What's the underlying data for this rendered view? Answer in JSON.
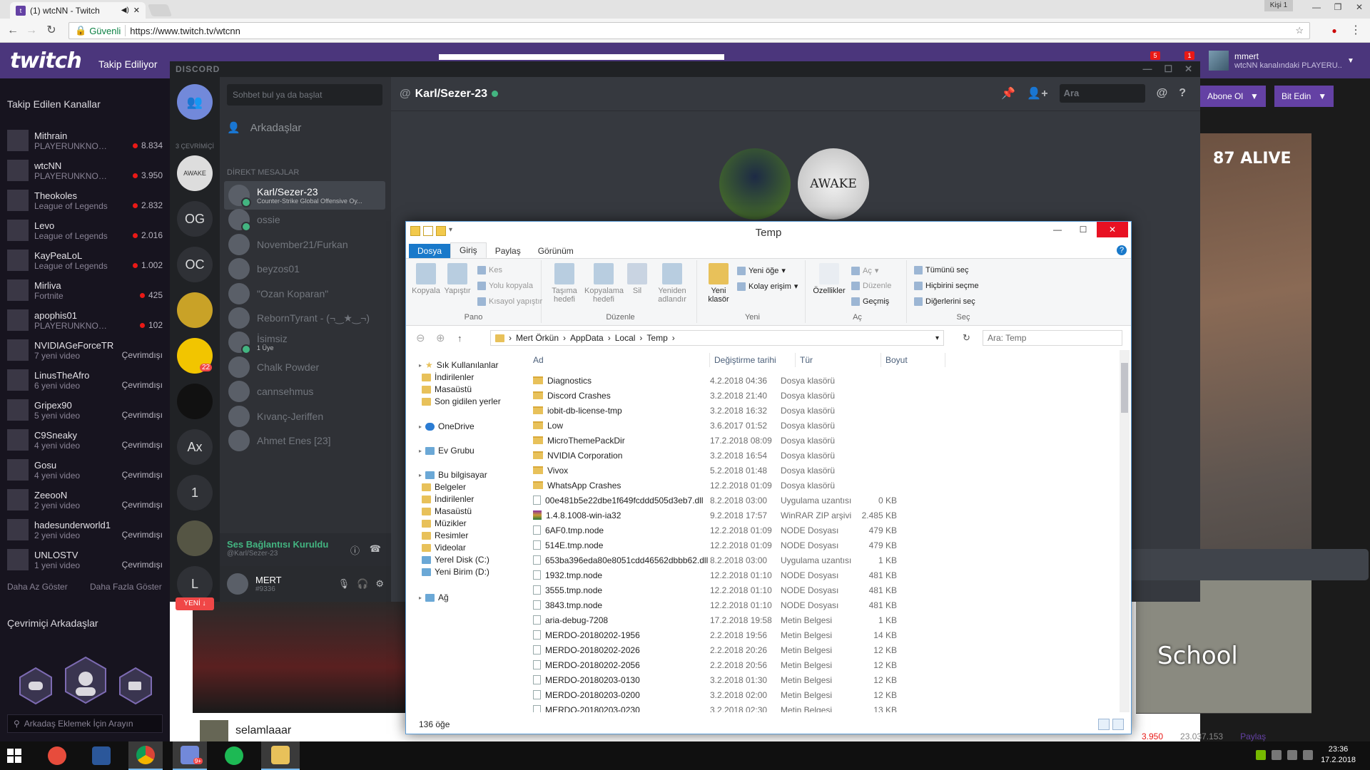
{
  "chrome": {
    "tab_title": "(1) wtcNN - Twitch",
    "profile_chip": "Kişi 1",
    "secure_label": "Güvenli",
    "url": "https://www.twitch.tv/wtcnn"
  },
  "twitch": {
    "logo": "twitch",
    "nav_following": "Takip Ediliyor",
    "user": {
      "name": "mmert",
      "subtitle": "wtcNN kanalındaki PLAYERU..."
    },
    "notif_badges": [
      "5",
      "1"
    ],
    "sidebar_title": "Takip Edilen Kanallar",
    "channels": [
      {
        "name": "Mithrain",
        "game": "PLAYERUNKNOWN'...",
        "stat": "8.834",
        "live": true
      },
      {
        "name": "wtcNN",
        "game": "PLAYERUNKNOWN'...",
        "stat": "3.950",
        "live": true
      },
      {
        "name": "Theokoles",
        "game": "League of Legends",
        "stat": "2.832",
        "live": true
      },
      {
        "name": "Levo",
        "game": "League of Legends",
        "stat": "2.016",
        "live": true
      },
      {
        "name": "KayPeaLoL",
        "game": "League of Legends",
        "stat": "1.002",
        "live": true
      },
      {
        "name": "Mirliva",
        "game": "Fortnite",
        "stat": "425",
        "live": true
      },
      {
        "name": "apophis01",
        "game": "PLAYERUNKNOWN'S ...",
        "stat": "102",
        "live": true
      },
      {
        "name": "NVIDIAGeForceTR",
        "game": "7 yeni video",
        "stat": "Çevrimdışı",
        "live": false
      },
      {
        "name": "LinusTheAfro",
        "game": "6 yeni video",
        "stat": "Çevrimdışı",
        "live": false
      },
      {
        "name": "Gripex90",
        "game": "5 yeni video",
        "stat": "Çevrimdışı",
        "live": false
      },
      {
        "name": "C9Sneaky",
        "game": "4 yeni video",
        "stat": "Çevrimdışı",
        "live": false
      },
      {
        "name": "Gosu",
        "game": "4 yeni video",
        "stat": "Çevrimdışı",
        "live": false
      },
      {
        "name": "ZeeooN",
        "game": "2 yeni video",
        "stat": "Çevrimdışı",
        "live": false
      },
      {
        "name": "hadesunderworld1",
        "game": "2 yeni video",
        "stat": "Çevrimdışı",
        "live": false
      },
      {
        "name": "UNLOSTV",
        "game": "1 yeni video",
        "stat": "Çevrimdışı",
        "live": false
      }
    ],
    "show_less": "Daha Az Göster",
    "show_more": "Daha Fazla Göster",
    "online_friends": "Çevrimiçi Arkadaşlar",
    "friend_search": "Arkadaş Eklemek İçin Arayın",
    "subscribe": "Abone Ol",
    "bits": "Bit Edin",
    "alive": "87 ALIVE",
    "map_label": "School",
    "chat_message": "selamlaaar",
    "viewers": "3.950",
    "views": "23.037.153",
    "share": "Paylaş"
  },
  "discord": {
    "title_brand": "DISCORD",
    "online_count": "3 ÇEVRİMİÇİ",
    "guilds": [
      "OG",
      "OC",
      "Ax",
      "1",
      "L"
    ],
    "guild_badge": "22",
    "new_label": "YENİ ↓",
    "search_placeholder": "Sohbet bul ya da başlat",
    "friends": "Arkadaşlar",
    "dm_header": "DİREKT MESAJLAR",
    "dms": [
      {
        "name": "Karl/Sezer-23",
        "sub": "Counter-Strike Global Offensive Oy...",
        "active": true
      },
      {
        "name": "ossie",
        "sub": ""
      },
      {
        "name": "November21/Furkan",
        "sub": ""
      },
      {
        "name": "beyzos01",
        "sub": ""
      },
      {
        "name": "\"Ozan Koparan\"",
        "sub": ""
      },
      {
        "name": "RebornTyrant - (¬‿★‿¬)",
        "sub": ""
      },
      {
        "name": "İsimsiz",
        "sub": "1 Üye"
      },
      {
        "name": "Chalk Powder",
        "sub": ""
      },
      {
        "name": "cannsehmus",
        "sub": ""
      },
      {
        "name": "Kıvanç-Jeriffen",
        "sub": ""
      },
      {
        "name": "Ahmet Enes [23]",
        "sub": ""
      }
    ],
    "voice_title": "Ses Bağlantısı Kuruldu",
    "voice_sub": "@Karl/Sezer-23",
    "username": "MERT",
    "usertag": "#9336",
    "chat_title": "Karl/Sezer-23",
    "chat_search": "Ara",
    "awake_label": "AWAKE"
  },
  "explorer": {
    "title": "Temp",
    "tabs": [
      "Dosya",
      "Giriş",
      "Paylaş",
      "Görünüm"
    ],
    "ribbon": {
      "pano": "Pano",
      "duzenle": "Düzenle",
      "yeni": "Yeni",
      "ac": "Aç",
      "sec": "Seç",
      "kopyala": "Kopyala",
      "yapistir": "Yapıştır",
      "kes": "Kes",
      "yolu_kopyala": "Yolu kopyala",
      "kisayol": "Kısayol yapıştır",
      "tasima": "Taşıma hedefi",
      "kopyalama": "Kopyalama hedefi",
      "sil": "Sil",
      "yeniden": "Yeniden adlandır",
      "yeni_klasor": "Yeni klasör",
      "yeni_oge": "Yeni öğe",
      "kolay_erisim": "Kolay erişim",
      "ozellikler": "Özellikler",
      "ac_btn": "Aç",
      "duzenle_btn": "Düzenle",
      "gecmis": "Geçmiş",
      "tumunu": "Tümünü seç",
      "hicbirini": "Hiçbirini seçme",
      "digerlerini": "Diğerlerini seç"
    },
    "path": [
      "Mert Örkün",
      "AppData",
      "Local",
      "Temp"
    ],
    "search_placeholder": "Ara: Temp",
    "nav": [
      {
        "label": "Sık Kullanılanlar",
        "indent": 0,
        "icon": "star"
      },
      {
        "label": "İndirilenler",
        "indent": 1
      },
      {
        "label": "Masaüstü",
        "indent": 1
      },
      {
        "label": "Son gidilen yerler",
        "indent": 1
      },
      {
        "label": "OneDrive",
        "indent": 0,
        "icon": "od"
      },
      {
        "label": "Ev Grubu",
        "indent": 0,
        "icon": "pc"
      },
      {
        "label": "Bu bilgisayar",
        "indent": 0,
        "icon": "pc"
      },
      {
        "label": "Belgeler",
        "indent": 1
      },
      {
        "label": "İndirilenler",
        "indent": 1
      },
      {
        "label": "Masaüstü",
        "indent": 1
      },
      {
        "label": "Müzikler",
        "indent": 1
      },
      {
        "label": "Resimler",
        "indent": 1
      },
      {
        "label": "Videolar",
        "indent": 1
      },
      {
        "label": "Yerel Disk (C:)",
        "indent": 1,
        "icon": "pc"
      },
      {
        "label": "Yeni Birim (D:)",
        "indent": 1,
        "icon": "pc"
      },
      {
        "label": "Ağ",
        "indent": 0,
        "icon": "pc"
      }
    ],
    "columns": {
      "name": "Ad",
      "date": "Değiştirme tarihi",
      "type": "Tür",
      "size": "Boyut"
    },
    "files": [
      {
        "name": "Diagnostics",
        "date": "4.2.2018 04:36",
        "type": "Dosya klasörü",
        "size": "",
        "k": "f"
      },
      {
        "name": "Discord Crashes",
        "date": "3.2.2018 21:40",
        "type": "Dosya klasörü",
        "size": "",
        "k": "f"
      },
      {
        "name": "iobit-db-license-tmp",
        "date": "3.2.2018 16:32",
        "type": "Dosya klasörü",
        "size": "",
        "k": "f"
      },
      {
        "name": "Low",
        "date": "3.6.2017 01:52",
        "type": "Dosya klasörü",
        "size": "",
        "k": "f"
      },
      {
        "name": "MicroThemePackDir",
        "date": "17.2.2018 08:09",
        "type": "Dosya klasörü",
        "size": "",
        "k": "f"
      },
      {
        "name": "NVIDIA Corporation",
        "date": "3.2.2018 16:54",
        "type": "Dosya klasörü",
        "size": "",
        "k": "f"
      },
      {
        "name": "Vivox",
        "date": "5.2.2018 01:48",
        "type": "Dosya klasörü",
        "size": "",
        "k": "f"
      },
      {
        "name": "WhatsApp Crashes",
        "date": "12.2.2018 01:09",
        "type": "Dosya klasörü",
        "size": "",
        "k": "f"
      },
      {
        "name": "00e481b5e22dbe1f649fcddd505d3eb7.dll",
        "date": "8.2.2018 03:00",
        "type": "Uygulama uzantısı",
        "size": "0 KB",
        "k": "d"
      },
      {
        "name": "1.4.8.1008-win-ia32",
        "date": "9.2.2018 17:57",
        "type": "WinRAR ZIP arşivi",
        "size": "2.485 KB",
        "k": "z"
      },
      {
        "name": "6AF0.tmp.node",
        "date": "12.2.2018 01:09",
        "type": "NODE Dosyası",
        "size": "479 KB",
        "k": "d"
      },
      {
        "name": "514E.tmp.node",
        "date": "12.2.2018 01:09",
        "type": "NODE Dosyası",
        "size": "479 KB",
        "k": "d"
      },
      {
        "name": "653ba396eda80e8051cdd46562dbbb62.dll",
        "date": "8.2.2018 03:00",
        "type": "Uygulama uzantısı",
        "size": "1 KB",
        "k": "d"
      },
      {
        "name": "1932.tmp.node",
        "date": "12.2.2018 01:10",
        "type": "NODE Dosyası",
        "size": "481 KB",
        "k": "d"
      },
      {
        "name": "3555.tmp.node",
        "date": "12.2.2018 01:10",
        "type": "NODE Dosyası",
        "size": "481 KB",
        "k": "d"
      },
      {
        "name": "3843.tmp.node",
        "date": "12.2.2018 01:10",
        "type": "NODE Dosyası",
        "size": "481 KB",
        "k": "d"
      },
      {
        "name": "aria-debug-7208",
        "date": "17.2.2018 19:58",
        "type": "Metin Belgesi",
        "size": "1 KB",
        "k": "d"
      },
      {
        "name": "MERDO-20180202-1956",
        "date": "2.2.2018 19:56",
        "type": "Metin Belgesi",
        "size": "14 KB",
        "k": "d"
      },
      {
        "name": "MERDO-20180202-2026",
        "date": "2.2.2018 20:26",
        "type": "Metin Belgesi",
        "size": "12 KB",
        "k": "d"
      },
      {
        "name": "MERDO-20180202-2056",
        "date": "2.2.2018 20:56",
        "type": "Metin Belgesi",
        "size": "12 KB",
        "k": "d"
      },
      {
        "name": "MERDO-20180203-0130",
        "date": "3.2.2018 01:30",
        "type": "Metin Belgesi",
        "size": "12 KB",
        "k": "d"
      },
      {
        "name": "MERDO-20180203-0200",
        "date": "3.2.2018 02:00",
        "type": "Metin Belgesi",
        "size": "12 KB",
        "k": "d"
      },
      {
        "name": "MERDO-20180203-0230",
        "date": "3.2.2018 02:30",
        "type": "Metin Belgesi",
        "size": "13 KB",
        "k": "d"
      }
    ],
    "item_count": "136 öğe"
  },
  "taskbar": {
    "time": "23:36",
    "date": "17.2.2018",
    "discord_badge": "9+"
  },
  "colors": {
    "twitch_purple": "#6441a4",
    "discord_bg": "#36393f",
    "explorer_blue": "#1979ca",
    "live_red": "#e91916"
  }
}
